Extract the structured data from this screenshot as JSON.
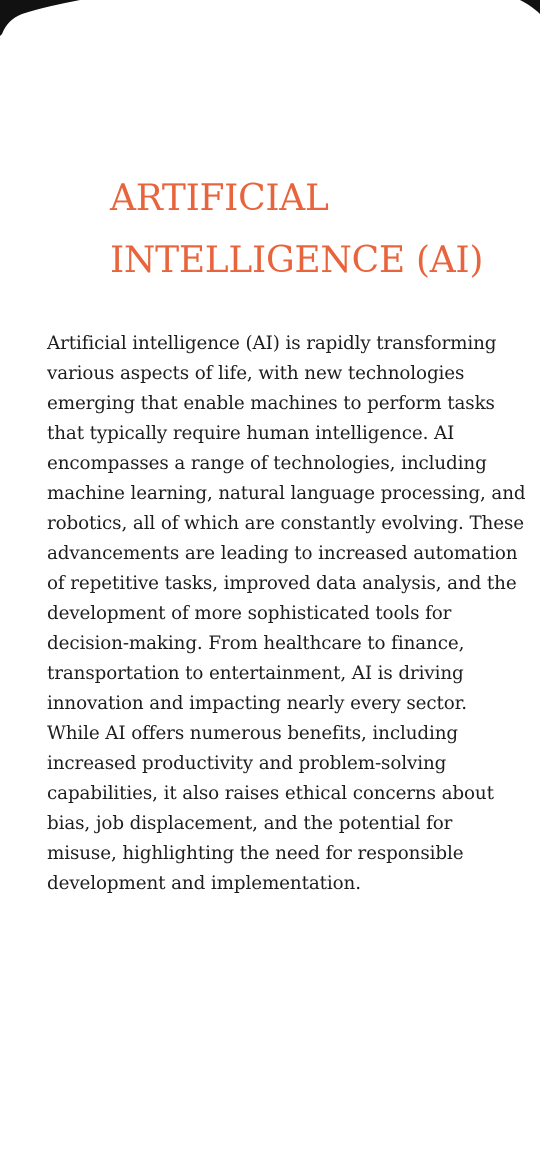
{
  "colors": {
    "title": "#E8643C",
    "text": "#1D1D1D",
    "background": "#FFFFFF",
    "corner": "#111111"
  },
  "document": {
    "title_lines": [
      "ARTIFICIAL",
      "INTELLIGENCE (AI)"
    ],
    "body_lines": [
      "Artificial intelligence (AI) is rapidly transforming",
      "various aspects of life, with new technologies",
      "emerging that enable machines to perform tasks",
      "that typically require human intelligence. AI",
      "encompasses a range of technologies, including",
      "machine learning, natural language processing, and",
      "robotics, all of which are constantly evolving. These",
      "advancements are leading to increased automation",
      "of repetitive tasks, improved data analysis, and the",
      "development of more sophisticated tools for",
      "decision-making. From healthcare to finance,",
      "transportation to entertainment, AI is driving",
      "innovation and impacting nearly every sector.",
      "While AI offers numerous benefits, including",
      "increased productivity and problem-solving",
      "capabilities, it also raises ethical concerns about",
      "bias, job displacement, and the potential for",
      "misuse, highlighting the need for responsible",
      "development and implementation."
    ]
  }
}
